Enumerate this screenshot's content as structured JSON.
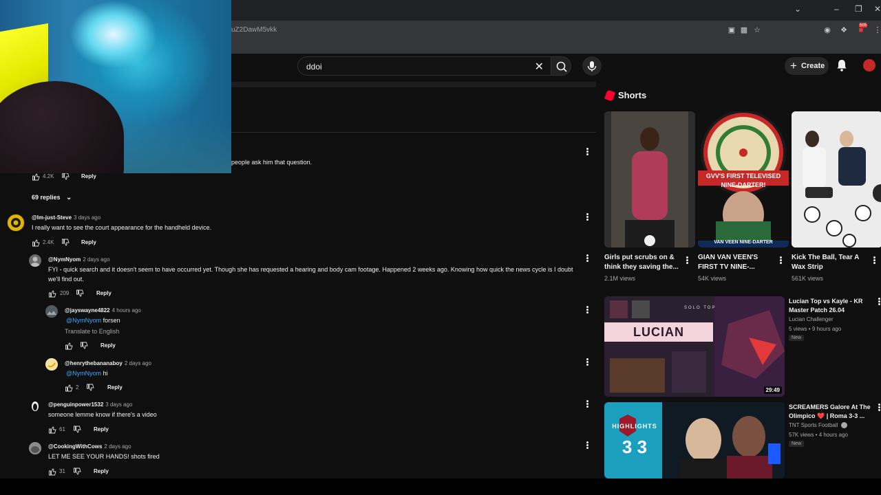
{
  "browser": {
    "url": "uZ2DawM5vkk",
    "extension_badge": "505"
  },
  "masthead": {
    "search_value": "ddoi",
    "create_label": "Create"
  },
  "comments": {
    "top_partial_text": "people ask him that question.",
    "top_likes": "4.2K",
    "reply_label": "Reply",
    "replies_toggle": "69 replies",
    "items": [
      {
        "author": "@Im-just-Steve",
        "time": "3 days ago",
        "text": "I really want to see the court appearance for the handheld device.",
        "likes": "2.4K"
      },
      {
        "author": "@NymNyom",
        "time": "2 days ago",
        "text_line1": "FYI - quick search and it doesn't seem to have occurred yet. Though she has requested a hearing and body cam footage. Happened 2 weeks ago. Knowing how quick the news cycle is I doubt",
        "text_line2": "we'll find out.",
        "likes": "209"
      },
      {
        "author": "@jayswayne4822",
        "time": "4 hours ago",
        "mention": "@NymNyom",
        "text": "forsen",
        "translate": "Translate to English",
        "likes": ""
      },
      {
        "author": "@henrythebananaboy",
        "time": "2 days ago",
        "mention": "@NymNyom",
        "text": "hi",
        "likes": "2"
      },
      {
        "author": "@penguinpower1532",
        "time": "3 days ago",
        "text": "someone lemme know if there's a video",
        "likes": "61"
      },
      {
        "author": "@CookingWithCows",
        "time": "2 days ago",
        "text": "LET ME SEE YOUR HANDS! shots fired",
        "likes": "31"
      }
    ]
  },
  "shorts": {
    "heading": "Shorts",
    "items": [
      {
        "title": "Girls put scrubs on & think they saving the...",
        "views": "2.1M views"
      },
      {
        "title": "GIAN VAN VEEN'S FIRST TV NINE-...",
        "views": "54K views",
        "overlay": "GVV'S FIRST TELEVISED NINE-DARTER!",
        "overlay2": "VAN VEEN NINE-DARTER"
      },
      {
        "title": "Kick The Ball, Tear A Wax Strip",
        "views": "561K views"
      }
    ]
  },
  "videos": [
    {
      "title": "Lucian Top vs Kayle - KR Master Patch 26.04",
      "channel": "Lucian Challenger",
      "meta": "5 views • 9 hours ago",
      "badge": "New",
      "duration": "29:49",
      "thumb_label": "LUCIAN",
      "thumb_sub": "SOLO TOP"
    },
    {
      "title": "SCREAMERS Galore At The Olimpico ❤️ | Roma 3-3 ...",
      "channel": "TNT Sports Football",
      "meta": "57K views • 4 hours ago",
      "badge": "New",
      "thumb_label": "HIGHLIGHTS",
      "thumb_score": "3 3"
    }
  ]
}
